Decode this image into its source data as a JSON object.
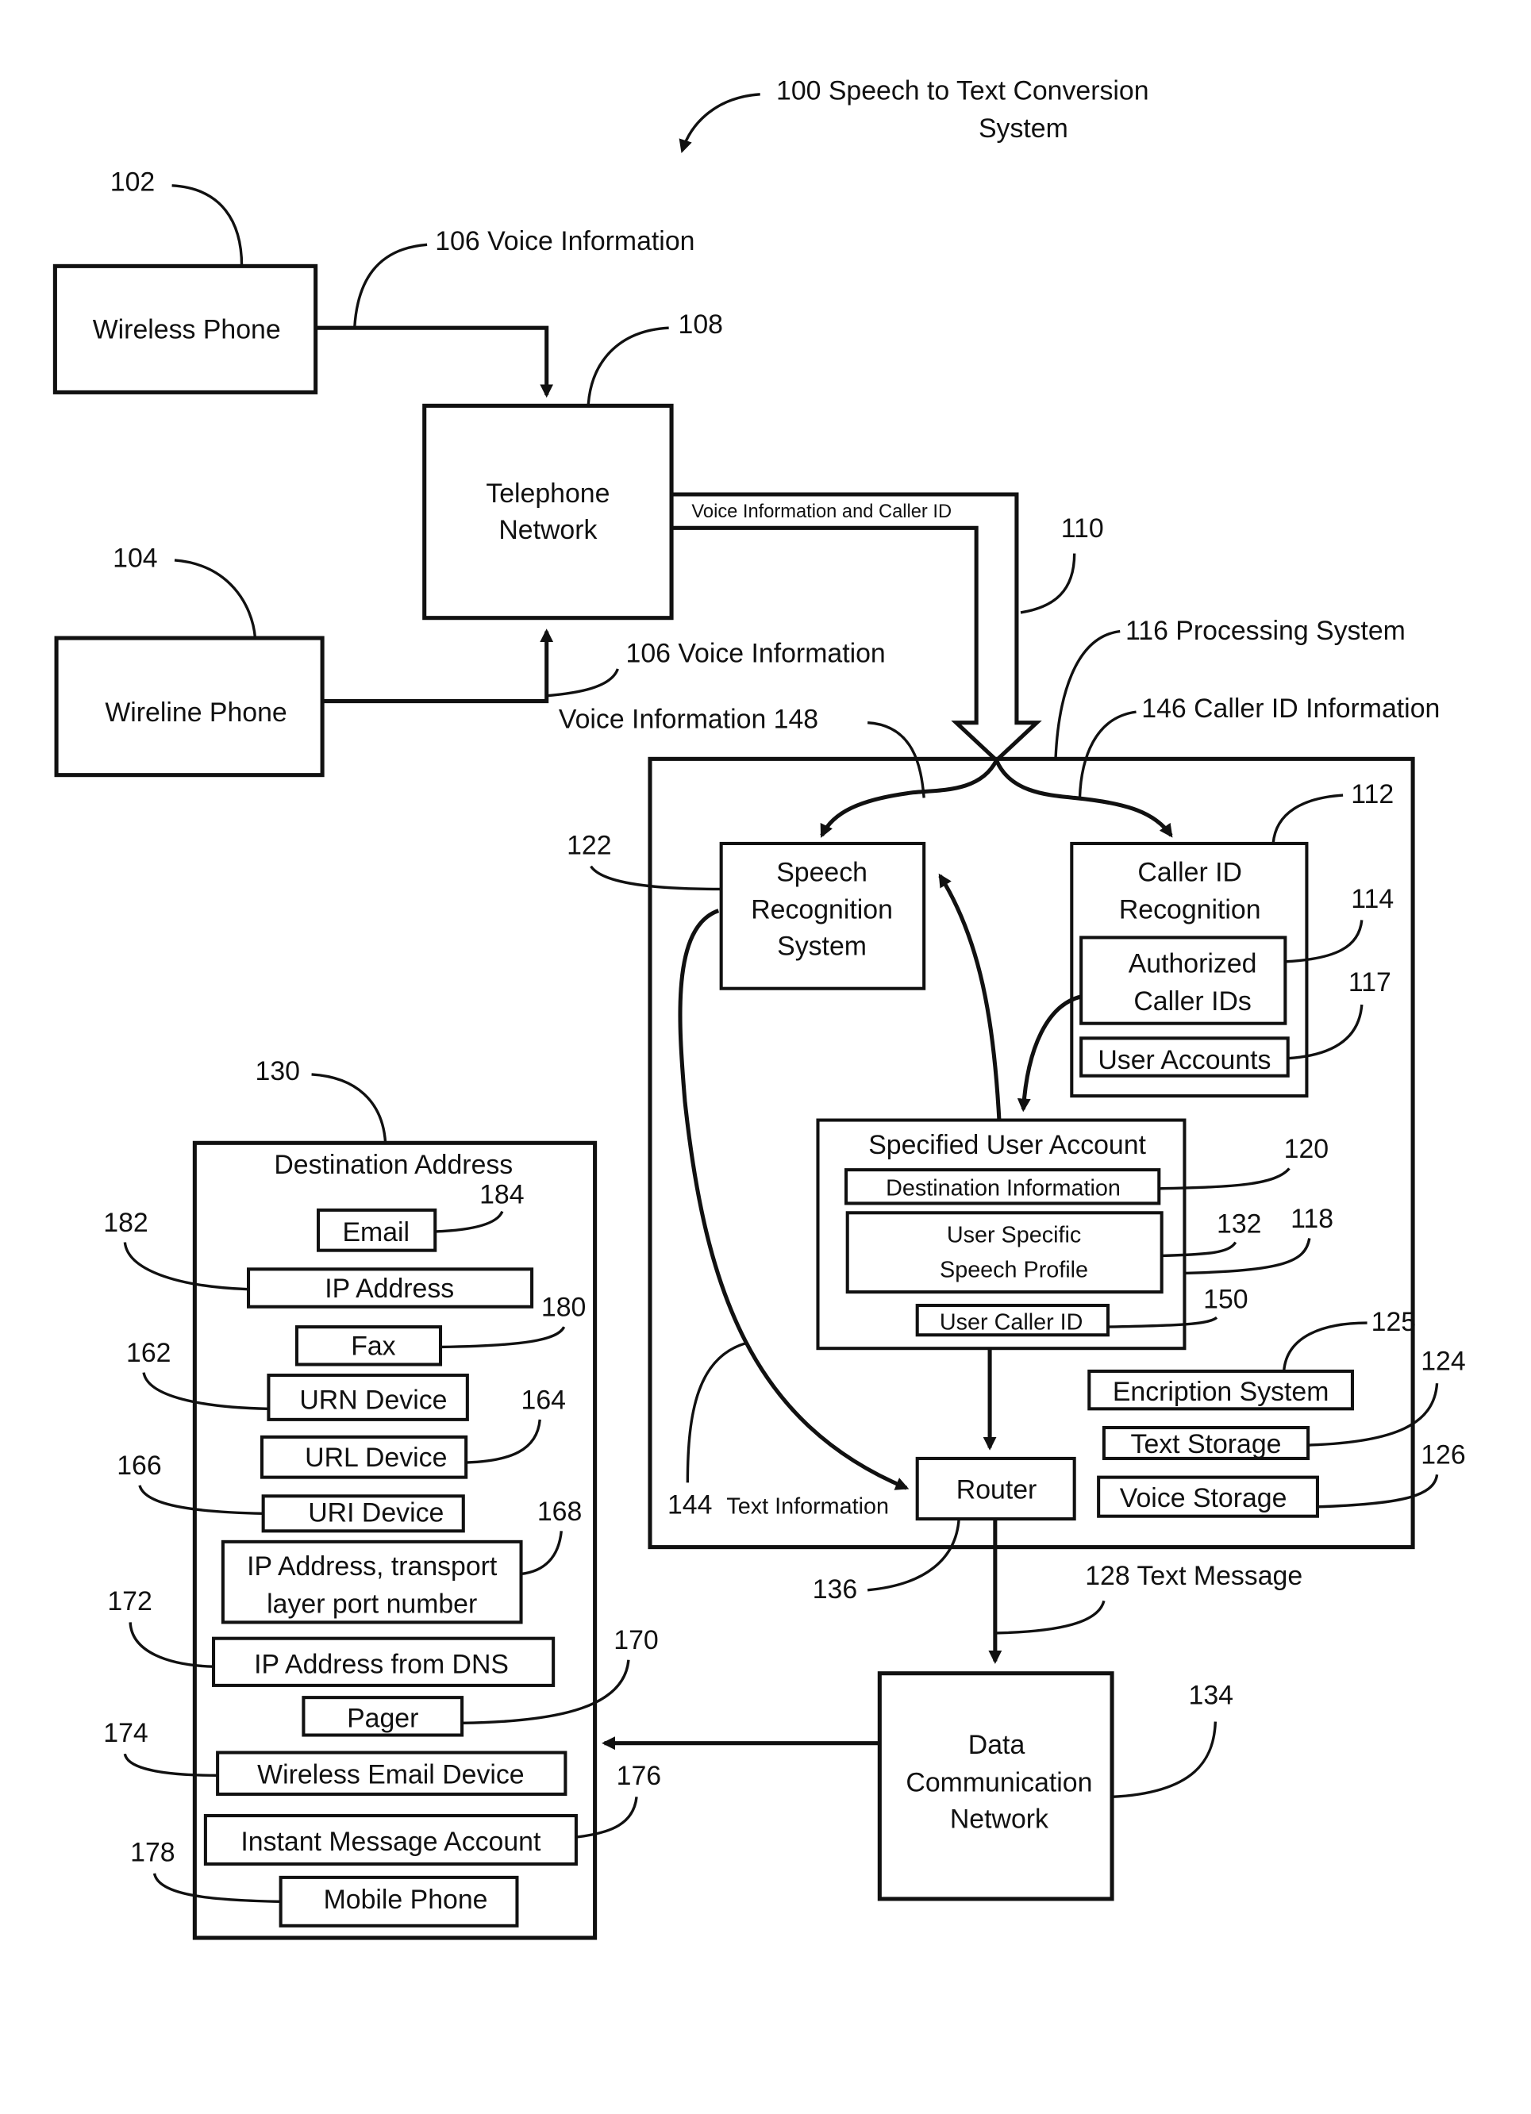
{
  "figure": {
    "title_line1": "100 Speech to Text Conversion",
    "title_line2": "System"
  },
  "nodes": {
    "wireless_phone": {
      "ref": "102",
      "label": "Wireless Phone"
    },
    "wireline_phone": {
      "ref": "104",
      "label": "Wireline Phone"
    },
    "telephone_network": {
      "ref": "108",
      "label_line1": "Telephone",
      "label_line2": "Network"
    },
    "processing_system": {
      "ref": "116",
      "label": "116 Processing System"
    },
    "speech_recognition": {
      "ref": "122",
      "label_line1": "Speech",
      "label_line2": "Recognition",
      "label_line3": "System"
    },
    "caller_id_recognition": {
      "ref": "112",
      "label_line1": "Caller ID",
      "label_line2": "Recognition"
    },
    "authorized_caller_ids": {
      "ref": "114",
      "label_line1": "Authorized",
      "label_line2": "Caller IDs"
    },
    "user_accounts": {
      "ref": "117",
      "label": "User Accounts"
    },
    "specified_user_account": {
      "ref": "118",
      "label": "Specified User Account"
    },
    "destination_information": {
      "ref": "120",
      "label": "Destination Information"
    },
    "speech_profile": {
      "ref": "132",
      "label_line1": "User Specific",
      "label_line2": "Speech Profile"
    },
    "user_caller_id": {
      "ref": "150",
      "label": "User Caller ID"
    },
    "encryption_system": {
      "ref": "125",
      "label": "Encription System"
    },
    "text_storage": {
      "ref": "124",
      "label": "Text Storage"
    },
    "voice_storage": {
      "ref": "126",
      "label": "Voice Storage"
    },
    "router": {
      "ref": "136",
      "label": "Router"
    },
    "data_network": {
      "ref": "134",
      "label_line1": "Data",
      "label_line2": "Communication",
      "label_line3": "Network"
    },
    "destination_address": {
      "ref": "130",
      "label": "Destination Address"
    }
  },
  "destinations": [
    {
      "ref": "184",
      "label": "Email"
    },
    {
      "ref": "182",
      "label": "IP Address"
    },
    {
      "ref": "180",
      "label": "Fax"
    },
    {
      "ref": "162",
      "label": "URN Device"
    },
    {
      "ref": "164",
      "label": "URL Device"
    },
    {
      "ref": "166",
      "label": "URI Device"
    },
    {
      "ref": "168",
      "label_line1": "IP Address, transport",
      "label_line2": "layer port number"
    },
    {
      "ref": "172",
      "label": "IP Address from DNS"
    },
    {
      "ref": "170",
      "label": "Pager"
    },
    {
      "ref": "174",
      "label": "Wireless Email Device"
    },
    {
      "ref": "176",
      "label": "Instant Message Account"
    },
    {
      "ref": "178",
      "label": "Mobile Phone"
    }
  ],
  "flows": {
    "voice_info_wireless": "106 Voice Information",
    "voice_info_wireline": "106 Voice Information",
    "voice_and_caller_id": "Voice Information and Caller ID",
    "channel_ref": "110",
    "voice_info_148": "Voice Information 148",
    "caller_id_146": "146 Caller ID Information",
    "text_info_144_num": "144",
    "text_info_144_label": "Text Information",
    "text_message_128": "128 Text Message"
  }
}
